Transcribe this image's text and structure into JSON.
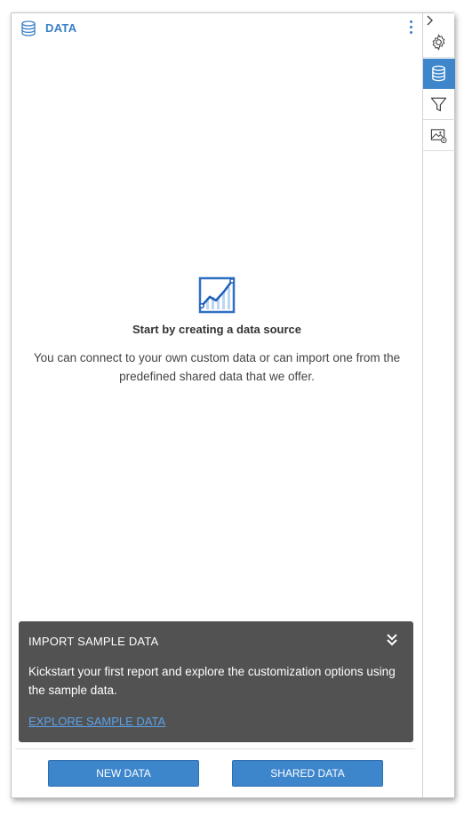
{
  "header": {
    "title": "DATA",
    "icon": "database-icon",
    "menu_icon": "kebab-menu-icon"
  },
  "empty_state": {
    "icon": "line-chart-icon",
    "title": "Start by creating a data source",
    "description": "You can connect to your own custom data or can import one from the predefined shared data that we offer."
  },
  "sample": {
    "title": "IMPORT SAMPLE DATA",
    "collapse_icon": "double-chevron-down-icon",
    "description": "Kickstart your first report and explore the customization options using the sample data.",
    "link": "EXPLORE SAMPLE DATA"
  },
  "actions": {
    "new_data": "NEW DATA",
    "shared_data": "SHARED DATA"
  },
  "rail": {
    "expand_icon": "chevron-right-icon",
    "items": [
      {
        "icon": "gear-icon",
        "active": false
      },
      {
        "icon": "database-icon",
        "active": true
      },
      {
        "icon": "filter-icon",
        "active": false
      },
      {
        "icon": "image-settings-icon",
        "active": false
      }
    ]
  },
  "colors": {
    "accent": "#3d86cc",
    "title_blue": "#3a7fc4",
    "card_bg": "#525252",
    "link": "#5aa3ec"
  }
}
